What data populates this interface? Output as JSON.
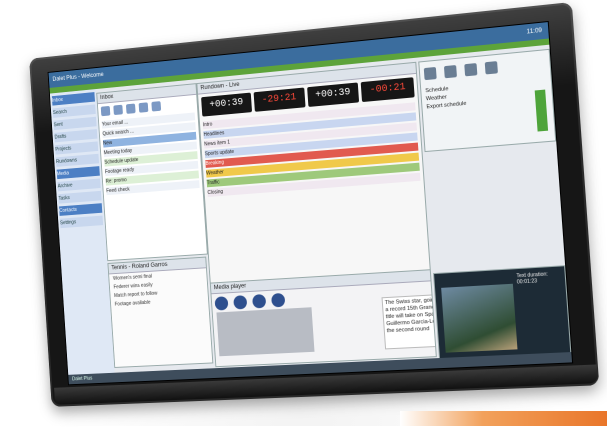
{
  "window": {
    "titlebar_text": "Dalet Plus - Welcome",
    "clock_time": "11:09",
    "statusbar_text": "Dalet Plus"
  },
  "left_sidebar": {
    "items": [
      "Inbox",
      "Search",
      "Sent",
      "Drafts",
      "Projects",
      "Rundowns",
      "Media",
      "Archive",
      "Tasks",
      "Contacts",
      "Settings"
    ]
  },
  "mail_panel": {
    "title": "Inbox",
    "rows": [
      "Your email ...",
      "Quick search ...",
      "New",
      "Meeting today",
      "Schedule update",
      "Footage ready",
      "Re: promo",
      "Feed check"
    ]
  },
  "document": {
    "title": "Tennis - Roland Garros",
    "lines": [
      "Women's semi final",
      "Federer wins easily",
      "Match report to follow",
      "Footage available"
    ]
  },
  "clock_panel": {
    "title": "Rundown - Live",
    "timers": [
      {
        "label": "+00:39",
        "red": false
      },
      {
        "label": "-29:21",
        "red": true
      },
      {
        "label": "+00:39",
        "red": false
      },
      {
        "label": "-00:21",
        "red": true
      }
    ],
    "rows": [
      {
        "text": "Intro",
        "style": ""
      },
      {
        "text": "Headlines",
        "style": "b"
      },
      {
        "text": "News item 1",
        "style": ""
      },
      {
        "text": "Sports update",
        "style": "b"
      },
      {
        "text": "Breaking",
        "style": "r"
      },
      {
        "text": "Weather",
        "style": "y"
      },
      {
        "text": "Traffic",
        "style": "g"
      },
      {
        "text": "Closing",
        "style": ""
      }
    ]
  },
  "player": {
    "title": "Media player",
    "note": "The Swiss star, going for a record 15th Grand Slam title will take on Spain's Guillermo Garcia-Lopez in the second round"
  },
  "right_panel": {
    "lines": [
      "Schedule",
      "Weather",
      "Export schedule"
    ]
  },
  "video": {
    "label": "Text duration: 00:01:23"
  }
}
